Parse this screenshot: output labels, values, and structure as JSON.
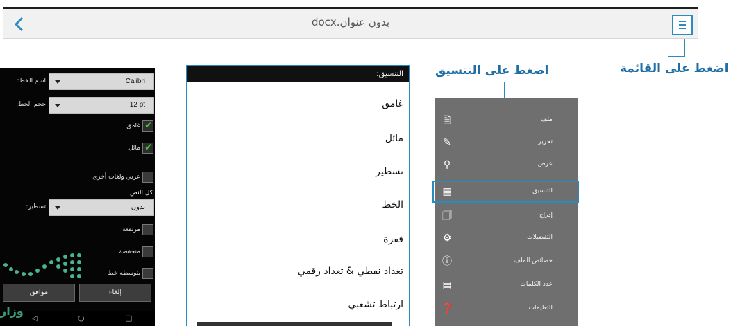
{
  "toolbar": {
    "title": "بدون عنوان.docx"
  },
  "callouts": {
    "press_menu": "اضغط على القائمة",
    "press_format": "اضغط على التنسيق"
  },
  "font_dialog": {
    "font_name_label": "اسم الخط:",
    "font_name_value": "Calibri",
    "font_size_label": "حجم الخط:",
    "font_size_value": "12 pt",
    "bold_label": "غامق",
    "italic_label": "مائل",
    "arabic_other_label": "عربي ولغات أخرى",
    "all_text_label": "كل النص",
    "underline_label": "تسطير:",
    "underline_value": "بدون",
    "raised_label": "مرتفعة",
    "lowered_label": "منخفضة",
    "strike_label": "يتوسطه خط",
    "ok_label": "موافق",
    "cancel_label": "إلغاء",
    "checks": {
      "bold": true,
      "italic": true,
      "arabic_other": false,
      "raised": false,
      "lowered": false,
      "strike": false
    }
  },
  "format_menu": {
    "header": "التنسيق:",
    "items": [
      "غامق",
      "مائل",
      "تسطير",
      "الخط",
      "فقرة",
      "تعداد نقطي & تعداد رقمي",
      "ارتباط تشعبي"
    ]
  },
  "app_menu": {
    "items": [
      {
        "label": "ملف",
        "icon": "file-icon"
      },
      {
        "label": "تحرير",
        "icon": "pencil-icon"
      },
      {
        "label": "عرض",
        "icon": "magnifier-icon"
      },
      {
        "label": "التنسيق",
        "icon": "format-icon"
      },
      {
        "label": "إدراج",
        "icon": "insert-icon"
      },
      {
        "label": "التفضيلات",
        "icon": "gear-icon"
      },
      {
        "label": "خصائص الملف",
        "icon": "info-icon"
      },
      {
        "label": "عدد الكلمات",
        "icon": "word-count-icon"
      },
      {
        "label": "التعليمات",
        "icon": "help-icon"
      }
    ],
    "selected": "التنسيق"
  },
  "watermark": {
    "text": "وزار"
  },
  "colors": {
    "accent": "#2a8bc0",
    "callout_text": "#1f6fa6",
    "menu_bg": "#6f6f6f",
    "check_green": "#46c23a"
  }
}
